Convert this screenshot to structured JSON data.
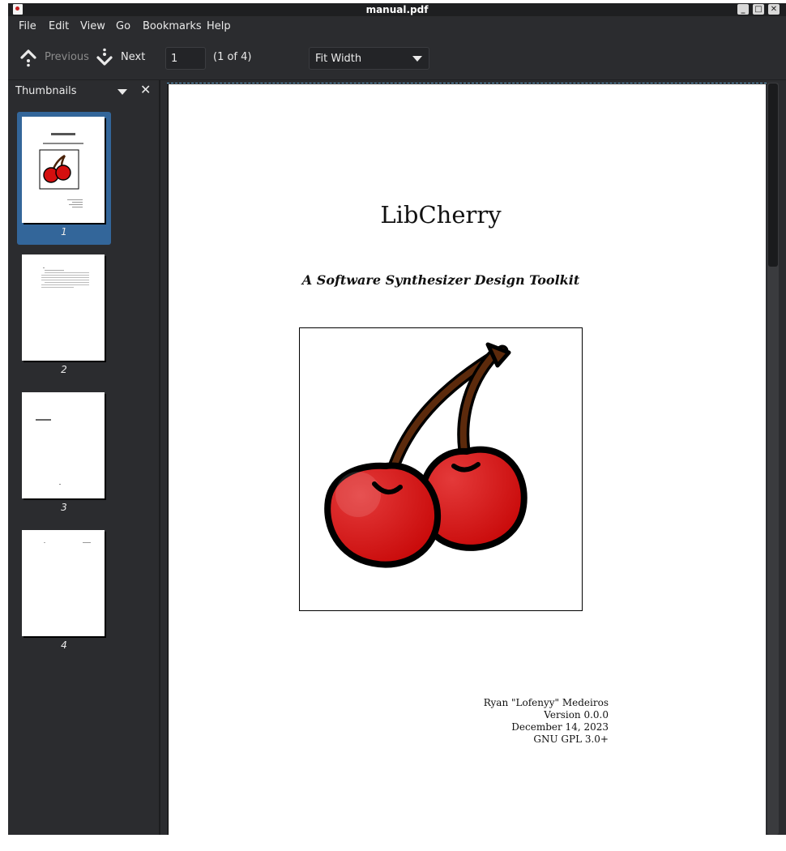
{
  "window": {
    "title": "manual.pdf",
    "buttons": [
      "_",
      "□",
      "✕"
    ]
  },
  "menu": [
    "File",
    "Edit",
    "View",
    "Go",
    "Bookmarks",
    "Help"
  ],
  "toolbar": {
    "previous_label": "Previous",
    "next_label": "Next",
    "page_value": "1",
    "page_count": "(1 of 4)",
    "zoom_value": "Fit Width"
  },
  "sidebar": {
    "title": "Thumbnails",
    "thumbnails": [
      {
        "number": "1",
        "selected": true
      },
      {
        "number": "2",
        "selected": false
      },
      {
        "number": "3",
        "selected": false
      },
      {
        "number": "4",
        "selected": false
      }
    ]
  },
  "document": {
    "title": "LibCherry",
    "subtitle": "A Software Synthesizer Design Toolkit",
    "credits": [
      "Ryan \"Lofenyy\" Medeiros",
      "Version 0.0.0",
      "December 14, 2023",
      "GNU GPL 3.0+"
    ]
  },
  "colors": {
    "accent": "#33669a",
    "cherry": "#d40f0f",
    "stem": "#5c2a0c"
  },
  "icons": [
    "previous-icon",
    "next-icon",
    "dropdown-icon",
    "close-icon"
  ]
}
